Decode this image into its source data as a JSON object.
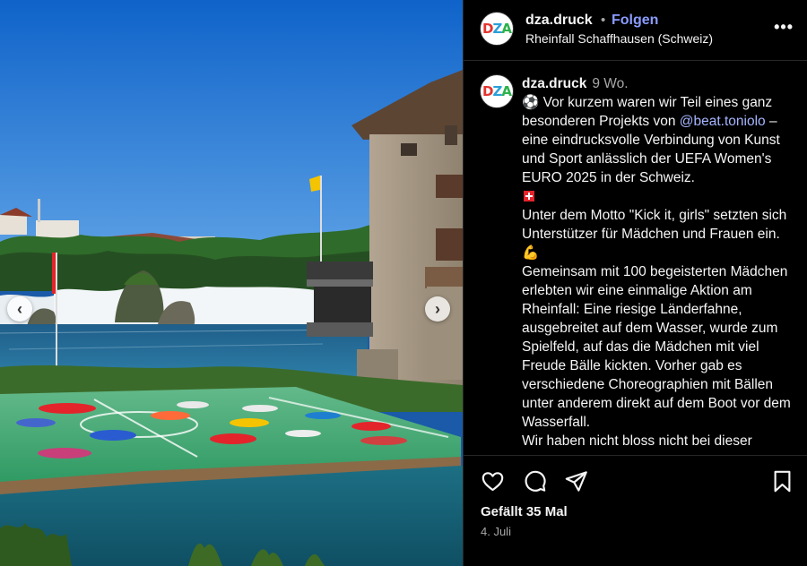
{
  "header": {
    "username": "dza.druck",
    "separator": "•",
    "follow_label": "Folgen",
    "location": "Rheinfall Schaffhausen (Schweiz)",
    "more_label": "•••"
  },
  "avatar": {
    "d": "D",
    "z": "Z",
    "a": "A"
  },
  "caption": {
    "username": "dza.druck",
    "time": "9 Wo.",
    "intro_before": "⚽ Vor kurzem waren wir Teil eines ganz besonderen Projekts von ",
    "mention": "@beat.toniolo",
    "intro_after": " – eine eindrucksvolle Verbindung von Kunst und Sport anlässlich der UEFA Women's EURO 2025 in der Schweiz.",
    "paragraph2": "Unter dem Motto \"Kick it, girls\" setzten sich Unterstützer für Mädchen und Frauen ein. 💪",
    "paragraph3": "Gemeinsam mit 100 begeisterten Mädchen erlebten wir eine einmalige Aktion am Rheinfall: Eine riesige Länderfahne, ausgebreitet auf dem Wasser, wurde zum Spielfeld, auf das die Mädchen mit viel Freude Bälle kickten. Vorher gab es verschiedene Choreographien mit Bällen unter anderem direkt auf dem Boot vor dem Wasserfall.",
    "paragraph4": "Wir haben nicht bloss nicht bei dieser"
  },
  "footer": {
    "likes": "Gefällt 35 Mal",
    "date": "4. Juli"
  },
  "icons": {
    "like": "heart-icon",
    "comment": "comment-icon",
    "share": "paper-plane-icon",
    "save": "bookmark-icon",
    "prev": "chevron-left-icon",
    "next": "chevron-right-icon"
  },
  "colors": {
    "background": "#000000",
    "follow": "#8a9cff",
    "mention": "#a5b6ff",
    "muted": "#a8a8a8"
  }
}
